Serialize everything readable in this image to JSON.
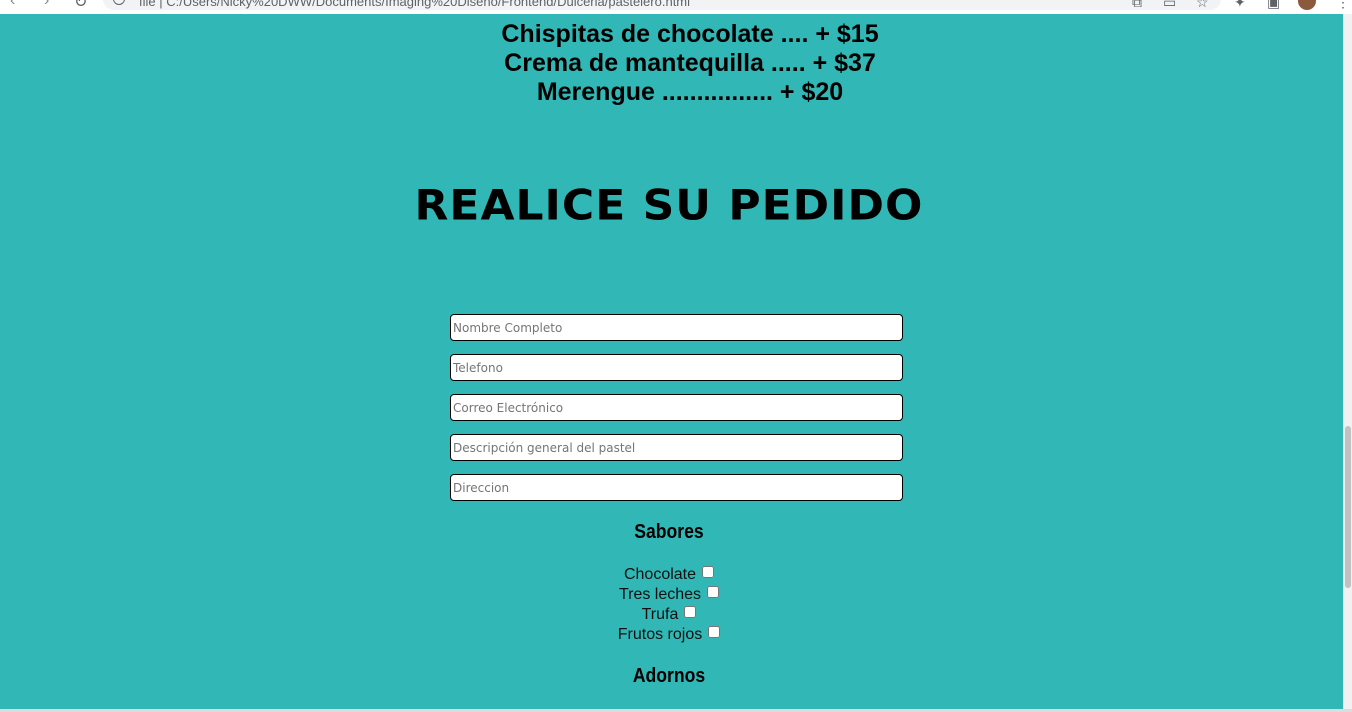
{
  "browser": {
    "url": "file  |  C:/Users/Nicky%20DWW/Documents/Imaging%20Diseño/Frontend/Dulceria/pastelero.html"
  },
  "toppings": [
    "Chispitas de chocolate .... + $15",
    "Crema de mantequilla ..... + $37",
    "Merengue ................ + $20"
  ],
  "order": {
    "title": "Realice su pedido",
    "fields": [
      {
        "placeholder": "Nombre Completo"
      },
      {
        "placeholder": "Telefono"
      },
      {
        "placeholder": "Correo Electrónico"
      },
      {
        "placeholder": "Descripción general del pastel"
      },
      {
        "placeholder": "Direccion"
      }
    ],
    "flavors_title": "Sabores",
    "flavors": [
      "Chocolate",
      "Tres leches",
      "Trufa",
      "Frutos rojos"
    ],
    "decorations_title": "Adornos"
  },
  "colors": {
    "background": "#31b7b5"
  }
}
